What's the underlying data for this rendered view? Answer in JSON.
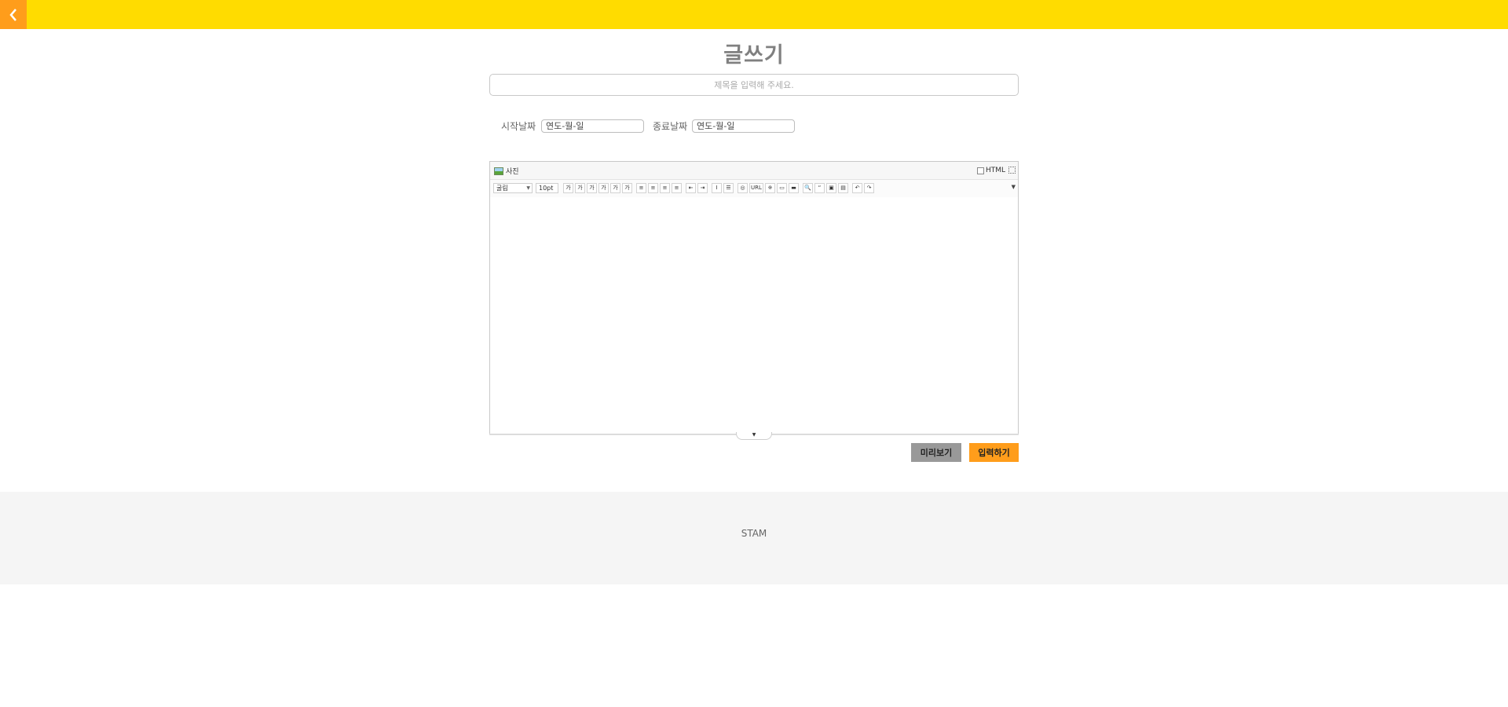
{
  "header": {
    "back_icon": "chevron-left-icon",
    "bar_color": "#ffdc00",
    "back_color": "#ff9d1b"
  },
  "page": {
    "title": "글쓰기"
  },
  "form": {
    "title_placeholder": "제목을 입력해 주세요.",
    "start_date_label": "시작날짜",
    "start_date_placeholder": "연도-월-일",
    "end_date_label": "종료날짜",
    "end_date_placeholder": "연도-월-일"
  },
  "editor": {
    "photo_label": "사진",
    "photo_icon": "image-icon",
    "html_label": "HTML",
    "fullscreen_icon": "fullscreen-icon",
    "font_select": "굴림",
    "size_select": "10pt",
    "toolbar_buttons": [
      {
        "name": "bold",
        "glyph": "가"
      },
      {
        "name": "underline",
        "glyph": "가"
      },
      {
        "name": "italic",
        "glyph": "가"
      },
      {
        "name": "strikethrough",
        "glyph": "가"
      },
      {
        "name": "font-color",
        "glyph": "가"
      },
      {
        "name": "background-color",
        "glyph": "가"
      },
      {
        "name": "align-left",
        "glyph": "≡"
      },
      {
        "name": "align-center",
        "glyph": "≡"
      },
      {
        "name": "align-right",
        "glyph": "≡"
      },
      {
        "name": "align-justify",
        "glyph": "≡"
      },
      {
        "name": "outdent",
        "glyph": "⇤"
      },
      {
        "name": "indent",
        "glyph": "⇥"
      },
      {
        "name": "line-height",
        "glyph": "Ι"
      },
      {
        "name": "list",
        "glyph": "☰"
      },
      {
        "name": "link",
        "glyph": "◎"
      },
      {
        "name": "url",
        "glyph": "URL"
      },
      {
        "name": "special-char",
        "glyph": "※"
      },
      {
        "name": "table",
        "glyph": "▭"
      },
      {
        "name": "hr",
        "glyph": "▬"
      },
      {
        "name": "find",
        "glyph": "🔍"
      },
      {
        "name": "quote",
        "glyph": "“"
      },
      {
        "name": "image",
        "glyph": "▣"
      },
      {
        "name": "save",
        "glyph": "▤"
      },
      {
        "name": "undo",
        "glyph": "↶"
      },
      {
        "name": "redo",
        "glyph": "↷"
      }
    ]
  },
  "actions": {
    "preview_label": "미리보기",
    "submit_label": "입력하기"
  },
  "footer": {
    "text": "STAM"
  }
}
